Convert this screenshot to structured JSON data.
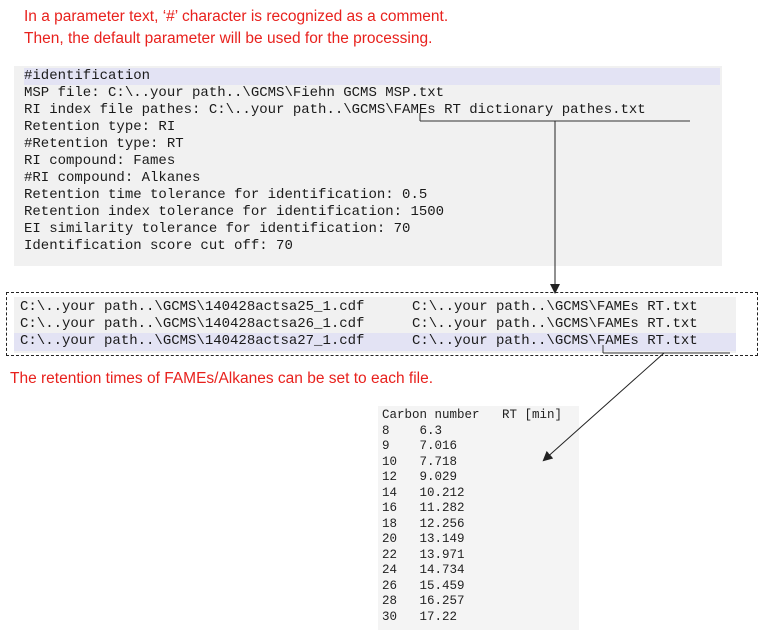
{
  "notes": {
    "comment_line1": "In a parameter text, ‘#’ character is recognized as a comment.",
    "comment_line2": "Then, the default parameter will be used for the processing.",
    "retention_note": "The retention times of FAMEs/Alkanes can be set to each file."
  },
  "param_file": {
    "lines": [
      "#identification",
      "MSP file: C:\\..your path..\\GCMS\\Fiehn GCMS MSP.txt",
      "RI index file pathes: C:\\..your path..\\GCMS\\FAMEs RT dictionary pathes.txt",
      "Retention type: RI",
      "#Retention type: RT",
      "RI compound: Fames",
      "#RI compound: Alkanes",
      "Retention time tolerance for identification: 0.5",
      "Retention index tolerance for identification: 1500",
      "EI similarity tolerance for identification: 70",
      "Identification score cut off: 70"
    ]
  },
  "dictionary_file": {
    "rows": [
      {
        "cdf": "C:\\..your path..\\GCMS\\140428actsa25_1.cdf",
        "rt": "C:\\..your path..\\GCMS\\FAMEs RT.txt"
      },
      {
        "cdf": "C:\\..your path..\\GCMS\\140428actsa26_1.cdf",
        "rt": "C:\\..your path..\\GCMS\\FAMEs RT.txt"
      },
      {
        "cdf": "C:\\..your path..\\GCMS\\140428actsa27_1.cdf",
        "rt": "C:\\..your path..\\GCMS\\FAMEs RT.txt"
      }
    ]
  },
  "rt_table": {
    "header": "Carbon number   RT [min]",
    "rows": [
      "8    6.3",
      "9    7.016",
      "10   7.718",
      "12   9.029",
      "14   10.212",
      "16   11.282",
      "18   12.256",
      "20   13.149",
      "22   13.971",
      "24   14.734",
      "26   15.459",
      "28   16.257",
      "30   17.22"
    ]
  }
}
